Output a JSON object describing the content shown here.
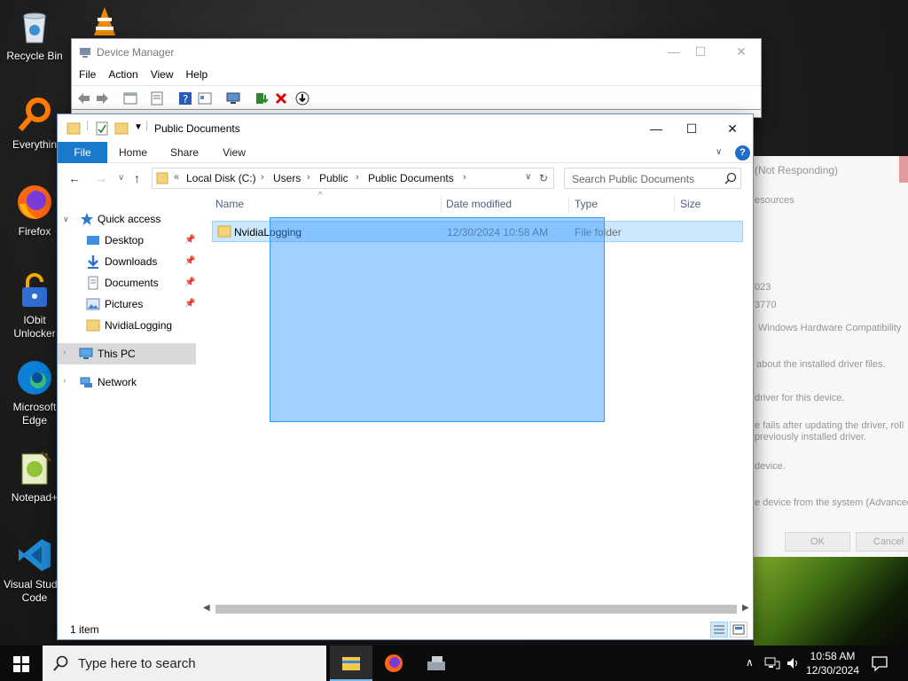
{
  "desktop": {
    "icons": [
      {
        "label": "Recycle Bin",
        "icon": "recycle-bin-icon"
      },
      {
        "label": "Everythin",
        "icon": "everything-search-icon"
      },
      {
        "label": "Firefox",
        "icon": "firefox-icon"
      },
      {
        "label": "IObit Unlocker",
        "icon": "iobit-unlocker-icon"
      },
      {
        "label": "Microsoft Edge",
        "icon": "edge-icon"
      },
      {
        "label": "Notepad+",
        "icon": "notepad-plus-plus-icon"
      },
      {
        "label": "Visual Studio Code",
        "icon": "vscode-icon"
      }
    ]
  },
  "background_dialog": {
    "title": "(Not Responding)",
    "tab": "esources",
    "lines": [
      "023",
      "3770",
      "Windows Hardware Compatibility",
      "about the installed driver files.",
      "driver for this device.",
      "e fails after updating the driver, roll",
      "previously installed driver.",
      "device.",
      "e device from the system (Advanced)."
    ],
    "ok": "OK",
    "cancel": "Cancel"
  },
  "device_manager": {
    "title": "Device Manager",
    "menu": [
      "File",
      "Action",
      "View",
      "Help"
    ]
  },
  "explorer": {
    "title": "Public Documents",
    "ribbon": {
      "file": "File",
      "home": "Home",
      "share": "Share",
      "view": "View"
    },
    "address": {
      "prefix": "«",
      "segments": [
        "Local Disk (C:)",
        "Users",
        "Public",
        "Public Documents"
      ]
    },
    "search_placeholder": "Search Public Documents",
    "nav": {
      "quick_access": "Quick access",
      "items": [
        "Desktop",
        "Downloads",
        "Documents",
        "Pictures",
        "NvidiaLogging"
      ],
      "this_pc": "This PC",
      "network": "Network"
    },
    "columns": {
      "name": "Name",
      "date": "Date modified",
      "type": "Type",
      "size": "Size"
    },
    "files": [
      {
        "name": "NvidiaLogging",
        "date": "12/30/2024 10:58 AM",
        "type": "File folder",
        "size": ""
      }
    ],
    "status": "1 item"
  },
  "taskbar": {
    "search_placeholder": "Type here to search",
    "time": "10:58 AM",
    "date": "12/30/2024"
  },
  "colors": {
    "accent": "#1979ca",
    "selection": "#cce8ff",
    "marquee": "#3399ff"
  }
}
